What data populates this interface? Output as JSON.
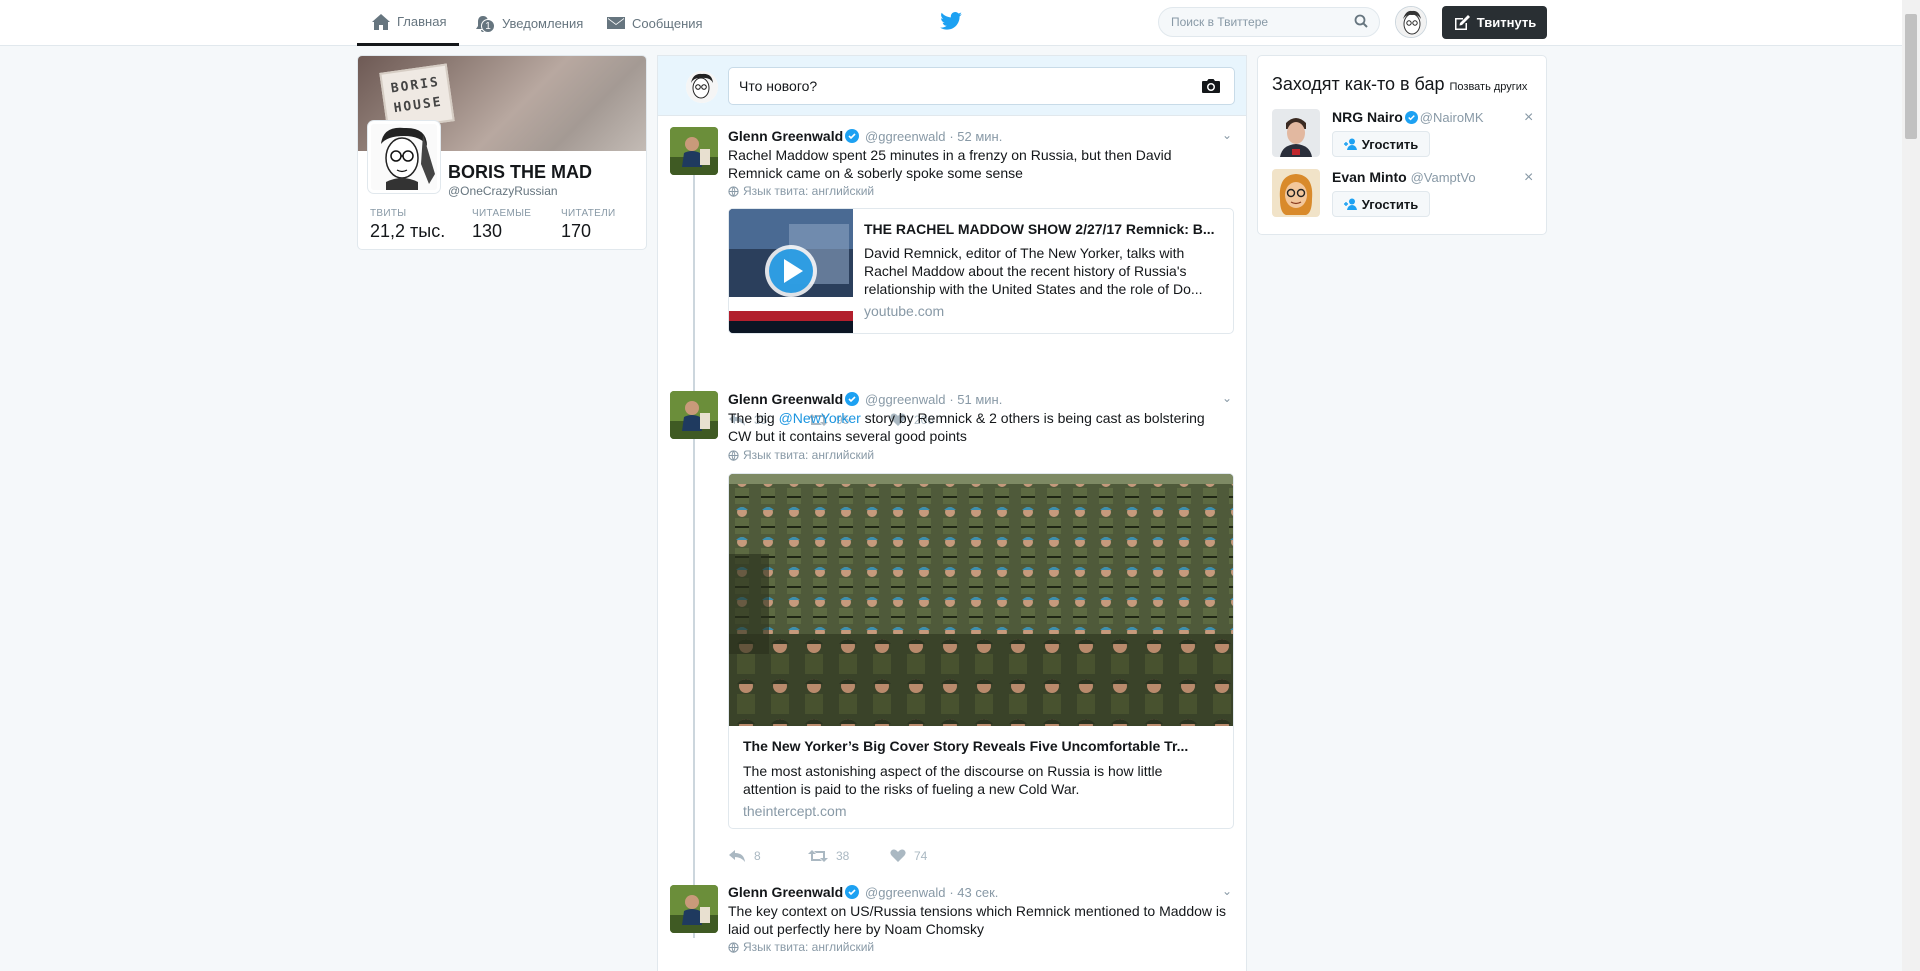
{
  "topbar": {
    "nav": [
      {
        "label": "Главная",
        "icon": "home-icon",
        "active": true
      },
      {
        "label": "Уведомления",
        "icon": "bell-icon",
        "badge": "1"
      },
      {
        "label": "Сообщения",
        "icon": "envelope-icon"
      }
    ],
    "logo": "twitter-bird-icon",
    "search_placeholder": "Поиск в Твиттере",
    "tweet_button": "Твитнуть"
  },
  "profile": {
    "banner_sign": "BORIS HOUSE",
    "name": "BORIS THE MAD",
    "handle": "@OneCrazyRussian",
    "stats": [
      {
        "label": "ТВИТЫ",
        "value": "21,2 тыс."
      },
      {
        "label": "ЧИТАЕМЫЕ",
        "value": "130"
      },
      {
        "label": "ЧИТАТЕЛИ",
        "value": "170"
      }
    ]
  },
  "composer": {
    "placeholder": "Что нового?"
  },
  "tweets": [
    {
      "name": "Glenn Greenwald",
      "handle": "@ggreenwald",
      "time": "· 52 мин.",
      "text": "Rachel Maddow spent 25 minutes in a frenzy on Russia, but then David Remnick came on & soberly spoke some sense",
      "lang": "Язык твита: английский",
      "card": {
        "title": "THE RACHEL MADDOW SHOW 2/27/17 Remnick: B...",
        "desc": "David Remnick, editor of The New Yorker, talks with Rachel Maddow about the recent history of Russia's relationship with the United States and the role of Do...",
        "domain": "youtube.com"
      },
      "replies": "35",
      "retweets": "95",
      "likes": "206"
    },
    {
      "name": "Glenn Greenwald",
      "handle": "@ggreenwald",
      "time": "· 51 мин.",
      "text_pre": "The big ",
      "mention": "@NewYorker",
      "text_post": " story by Remnick & 2 others is being cast as bolstering CW but it contains several good points",
      "lang": "Язык твита: английский",
      "card": {
        "title": "The New Yorker’s Big Cover Story Reveals Five Uncomfortable Tr...",
        "desc": "The most astonishing aspect of the discourse on Russia is how little attention is paid to the risks of fueling a new Cold War.",
        "domain": "theintercept.com"
      },
      "replies": "8",
      "retweets": "38",
      "likes": "74"
    },
    {
      "name": "Glenn Greenwald",
      "handle": "@ggreenwald",
      "time": "· 43 сек.",
      "text": "The key context on US/Russia tensions which Remnick mentioned to Maddow is laid out perfectly here by Noam Chomsky",
      "lang": "Язык твита: английский"
    }
  ],
  "who_to_follow": {
    "title": "Заходят как-то в бар",
    "invite": "Позвать других",
    "follow_label": "Угостить",
    "users": [
      {
        "name": "NRG Nairo",
        "handle": "@NairoMK"
      },
      {
        "name": "Evan Minto",
        "handle": "@VamptVo"
      }
    ]
  },
  "colors": {
    "accent": "#1da1f2",
    "dark_button": "#292f33",
    "verified": "#1da1f2"
  }
}
